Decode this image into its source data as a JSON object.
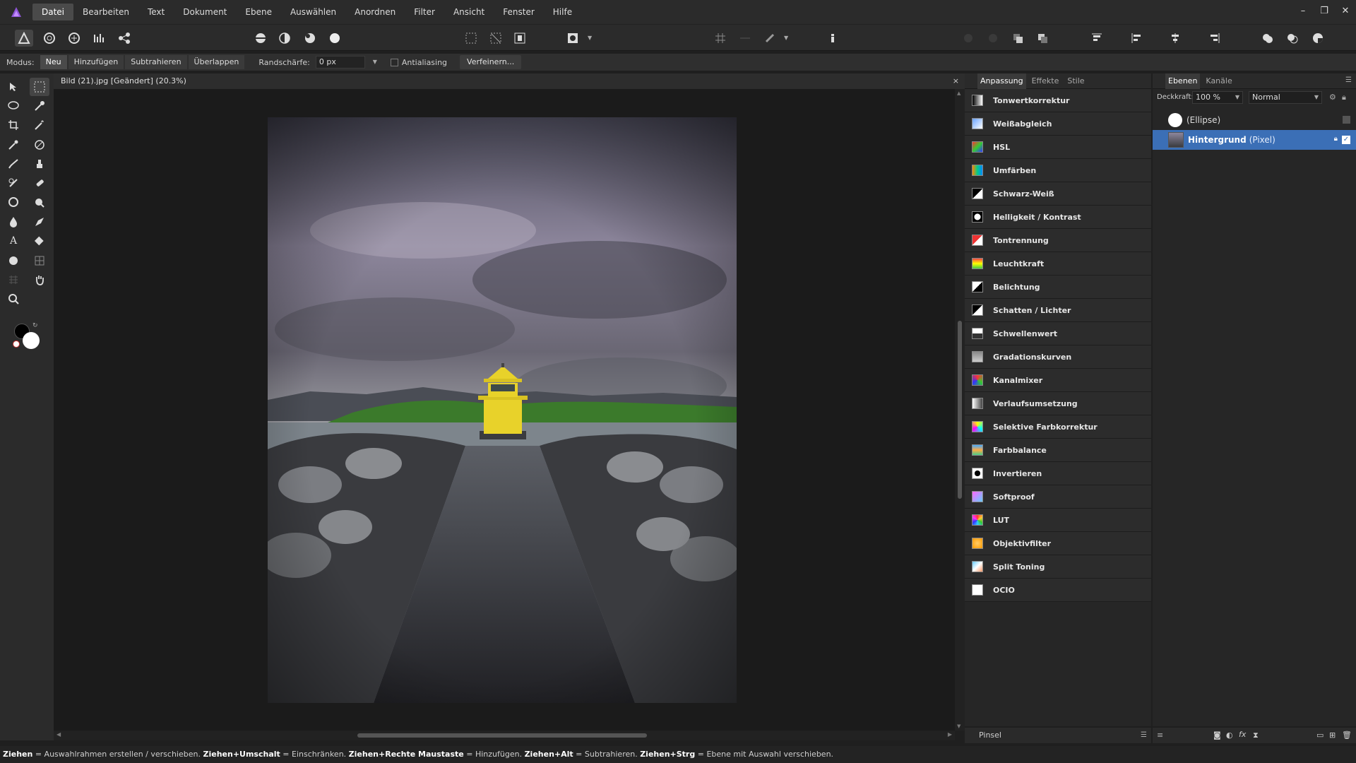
{
  "menu": [
    "Datei",
    "Bearbeiten",
    "Text",
    "Dokument",
    "Ebene",
    "Auswählen",
    "Anordnen",
    "Filter",
    "Ansicht",
    "Fenster",
    "Hilfe"
  ],
  "context": {
    "mode_label": "Modus:",
    "mode_options": [
      "Neu",
      "Hinzufügen",
      "Subtrahieren",
      "Überlappen"
    ],
    "feather_label": "Randschärfe:",
    "feather_value": "0 px",
    "antialias_label": "Antialiasing",
    "refine_label": "Verfeinern..."
  },
  "document": {
    "title": "Bild (21).jpg [Geändert] (20.3%)",
    "close": "×"
  },
  "adjustments": {
    "tabs": [
      "Anpassung",
      "Effekte",
      "Stile"
    ],
    "items": [
      "Tonwertkorrektur",
      "Weißabgleich",
      "HSL",
      "Umfärben",
      "Schwarz-Weiß",
      "Helligkeit / Kontrast",
      "Tontrennung",
      "Leuchtkraft",
      "Belichtung",
      "Schatten / Lichter",
      "Schwellenwert",
      "Gradationskurven",
      "Kanalmixer",
      "Verlaufsumsetzung",
      "Selektive Farbkorrektur",
      "Farbbalance",
      "Invertieren",
      "Softproof",
      "LUT",
      "Objektivfilter",
      "Split Toning",
      "OCIO"
    ]
  },
  "layers": {
    "tabs": [
      "Ebenen",
      "Kanäle"
    ],
    "opacity_label": "Deckkraft:",
    "opacity_value": "100 %",
    "blend_mode": "Normal",
    "rows": [
      {
        "name": "(Ellipse)",
        "type": ""
      },
      {
        "name": "Hintergrund",
        "type": "(Pixel)"
      }
    ]
  },
  "brush_panel": "Pinsel",
  "status": [
    {
      "k": "Ziehen",
      "v": " = Auswahlrahmen erstellen / verschieben. "
    },
    {
      "k": "Ziehen+Umschalt",
      "v": " = Einschränken. "
    },
    {
      "k": "Ziehen+Rechte Maustaste",
      "v": " = Hinzufügen. "
    },
    {
      "k": "Ziehen+Alt",
      "v": " = Subtrahieren. "
    },
    {
      "k": "Ziehen+Strg",
      "v": " = Ebene mit Auswahl verschieben."
    }
  ],
  "colors": {
    "accent": "#3b6fb6",
    "lighthouse": "#e8d22a"
  }
}
